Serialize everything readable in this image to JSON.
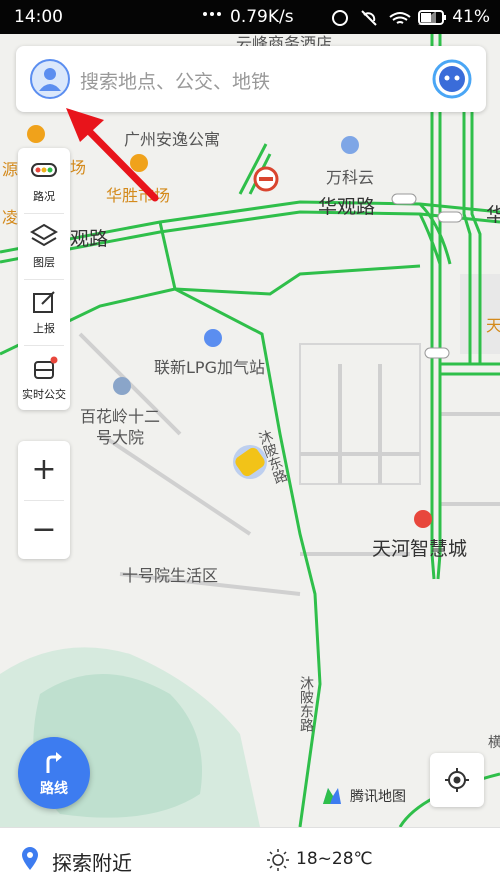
{
  "status_bar": {
    "time": "14:00",
    "net_speed": "0.79K/s",
    "battery": "41%"
  },
  "search": {
    "placeholder": "搜索地点、公交、地铁"
  },
  "map_labels": {
    "top_cut": "云峰商务酒店",
    "apartment": "广州安逸公寓",
    "market": "华胜市场",
    "wankeyun": "万科云",
    "huaguan_road_1": "华观路",
    "huaguan_road_2": "观路",
    "lpg": "联新LPG加气站",
    "baihualing": "百花岭十二\n号大院",
    "muyi_road_1": "沐陂东路",
    "muyi_road_2": "沐陂东路",
    "tianhe_city": "天河智慧城",
    "shihaoyuan": "十号院生活区",
    "edge_yuan": "源",
    "edge_ling": "凌",
    "edge_chang": "场",
    "edge_hua": "华",
    "edge_tian": "天",
    "edge_heng": "横"
  },
  "tools": [
    {
      "label": "路况",
      "icon": "traffic-icon"
    },
    {
      "label": "图层",
      "icon": "layers-icon"
    },
    {
      "label": "上报",
      "icon": "report-icon"
    },
    {
      "label": "实时公交",
      "icon": "realtime-bus-icon"
    }
  ],
  "zoom": {
    "in": "+",
    "out": "−"
  },
  "route_button": {
    "label": "路线"
  },
  "brand": {
    "name": "腾讯地图"
  },
  "bottom": {
    "explore": "探索附近",
    "weather": "18~28℃"
  },
  "colors": {
    "road_green": "#2fbf4a",
    "accent_blue": "#3d7cf0",
    "annotation_red": "#e8141b"
  }
}
